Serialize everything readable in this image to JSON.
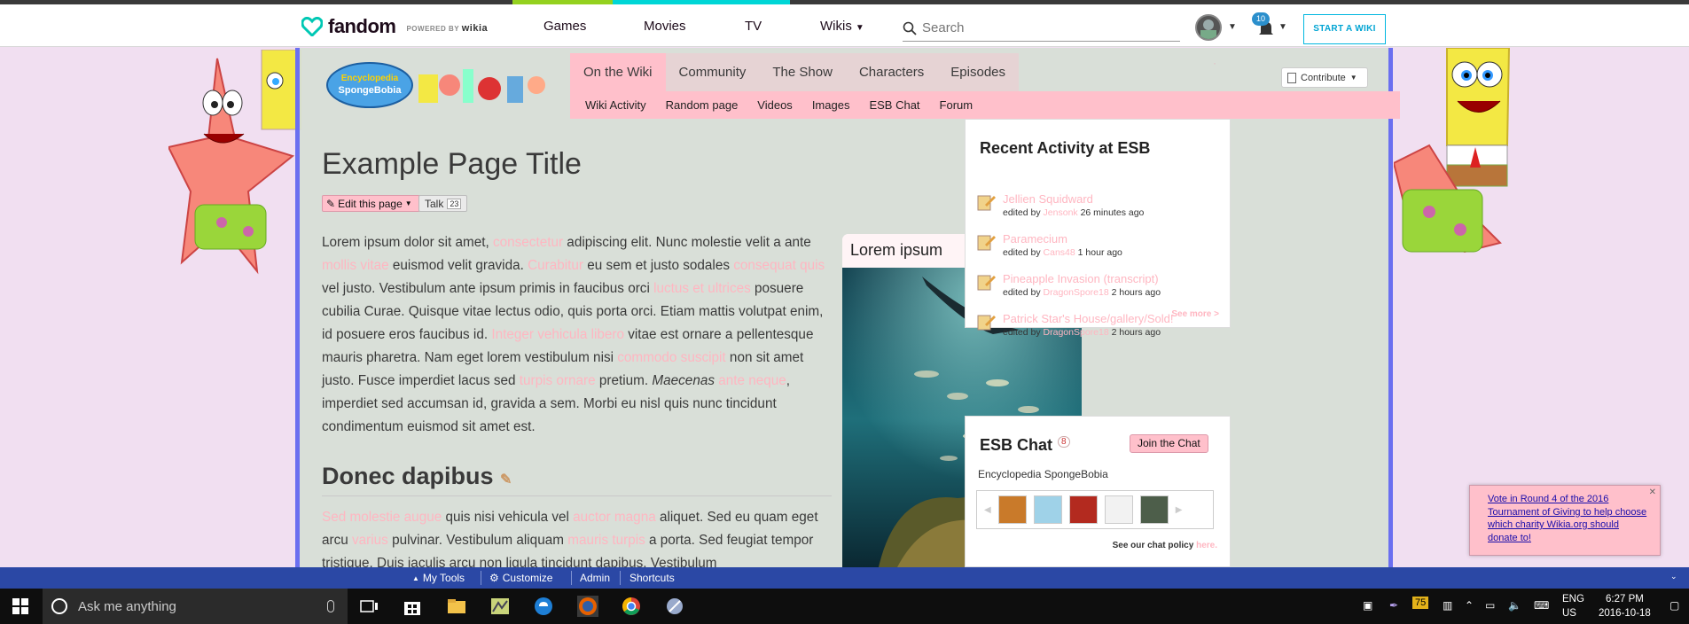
{
  "colors": {
    "strip": [
      "#3a3a3a",
      "#3a3a3a",
      "#94d11f",
      "#00d6d6",
      "#3a3a3a"
    ],
    "accent_pink": "#ffc0cb",
    "link_pink": "#ffb6c1",
    "rail_border_blue": "#6b6ff0",
    "toolbar_blue": "#2b48a5"
  },
  "globalnav": {
    "brand": "fandom",
    "powered_by": "POWERED BY",
    "powered_brand": "wikia",
    "links": [
      {
        "label": "Games"
      },
      {
        "label": "Movies"
      },
      {
        "label": "TV"
      },
      {
        "label": "Wikis"
      }
    ],
    "search_placeholder": "Search",
    "notification_count": "10",
    "start_wiki": "START A WIKI"
  },
  "wiki": {
    "logo_text": "Encyclopedia SpongeBobia",
    "tabs": [
      "On the Wiki",
      "Community",
      "The Show",
      "Characters",
      "Episodes"
    ],
    "subtabs": [
      "Wiki Activity",
      "Random page",
      "Videos",
      "Images",
      "ESB Chat",
      "Forum"
    ],
    "contribute": "Contribute",
    "page_title": "Example Page Title",
    "edit_label": "Edit this page",
    "talk_label": "Talk",
    "talk_count": "23",
    "share_icons": [
      "facebook-icon",
      "twitter-icon",
      "reddit-icon",
      "tumblr-icon"
    ]
  },
  "article": {
    "p1": [
      {
        "t": "Lorem ipsum dolor sit amet, ",
        "l": false
      },
      {
        "t": "consectetur",
        "l": true
      },
      {
        "t": " adipiscing elit. Nunc molestie velit a ante ",
        "l": false
      },
      {
        "t": "mollis vitae",
        "l": true
      },
      {
        "t": " euismod velit gravida. ",
        "l": false
      },
      {
        "t": "Curabitur",
        "l": true
      },
      {
        "t": " eu sem et justo sodales ",
        "l": false
      },
      {
        "t": "consequat quis",
        "l": true
      },
      {
        "t": " vel justo. Vestibulum ante ipsum primis in faucibus orci ",
        "l": false
      },
      {
        "t": "luctus et ultrices",
        "l": true
      },
      {
        "t": " posuere cubilia Curae. Quisque vitae lectus odio, quis porta orci. Etiam mattis volutpat enim, id posuere eros faucibus id. ",
        "l": false
      },
      {
        "t": "Integer vehicula libero",
        "l": true
      },
      {
        "t": " vitae est ornare a pellentesque mauris pharetra. Nam eget lorem vestibulum nisi ",
        "l": false
      },
      {
        "t": "commodo suscipit",
        "l": true
      },
      {
        "t": " non sit amet justo. Fusce imperdiet lacus sed ",
        "l": false
      },
      {
        "t": "turpis ornare",
        "l": true
      },
      {
        "t": " pretium. ",
        "l": false
      },
      {
        "t": "Maecenas",
        "l": false,
        "i": true
      },
      {
        "t": " ",
        "l": false
      },
      {
        "t": "ante neque",
        "l": true
      },
      {
        "t": ", imperdiet sed accumsan id, gravida a sem. Morbi eu nisl quis nunc tincidunt condimentum euismod sit amet est.",
        "l": false
      }
    ],
    "section_title": "Donec dapibus",
    "p2": [
      {
        "t": "Sed molestie augue",
        "l": true
      },
      {
        "t": " quis nisi vehicula vel ",
        "l": false
      },
      {
        "t": "auctor magna",
        "l": true
      },
      {
        "t": " aliquet. Sed eu quam eget arcu ",
        "l": false
      },
      {
        "t": "varius",
        "l": true
      },
      {
        "t": " pulvinar. Vestibulum aliquam ",
        "l": false
      },
      {
        "t": "mauris turpis",
        "l": true
      },
      {
        "t": " a porta. Sed feugiat tempor tristique. Duis iaculis arcu non ligula tincidunt dapibus. Vestibulum",
        "l": false
      }
    ]
  },
  "infobox": {
    "title": "Lorem ipsum"
  },
  "rail": {
    "activity_title": "Recent Activity at ESB",
    "activity": [
      {
        "title": "Jellien Squidward",
        "edited_by": "edited by",
        "user": "Jensonk",
        "time": "26 minutes ago"
      },
      {
        "title": "Paramecium",
        "edited_by": "edited by",
        "user": "Cans48",
        "time": "1 hour ago"
      },
      {
        "title": "Pineapple Invasion (transcript)",
        "edited_by": "edited by",
        "user": "DragonSpore18",
        "time": "2 hours ago"
      },
      {
        "title": "Patrick Star's House/gallery/Sold!",
        "edited_by": "edited by",
        "user": "DragonSpore18",
        "time": "2 hours ago"
      }
    ],
    "see_more": "See more >",
    "chat_title": "ESB Chat",
    "chat_count": "8",
    "join_chat": "Join the Chat",
    "chat_wiki": "Encyclopedia SpongeBobia",
    "chat_policy": "See our chat policy",
    "chat_policy_link": "here."
  },
  "vote": {
    "text": "Vote in Round 4 of the 2016 Tournament of Giving to help choose which charity Wikia.org should donate to!"
  },
  "toolbar": {
    "items": [
      "My Tools",
      "Customize",
      "Admin",
      "Shortcuts"
    ]
  },
  "taskbar": {
    "search_placeholder": "Ask me anything",
    "lang": "ENG",
    "region": "US",
    "time": "6:27 PM",
    "date": "2016-10-18",
    "badge": "75"
  }
}
